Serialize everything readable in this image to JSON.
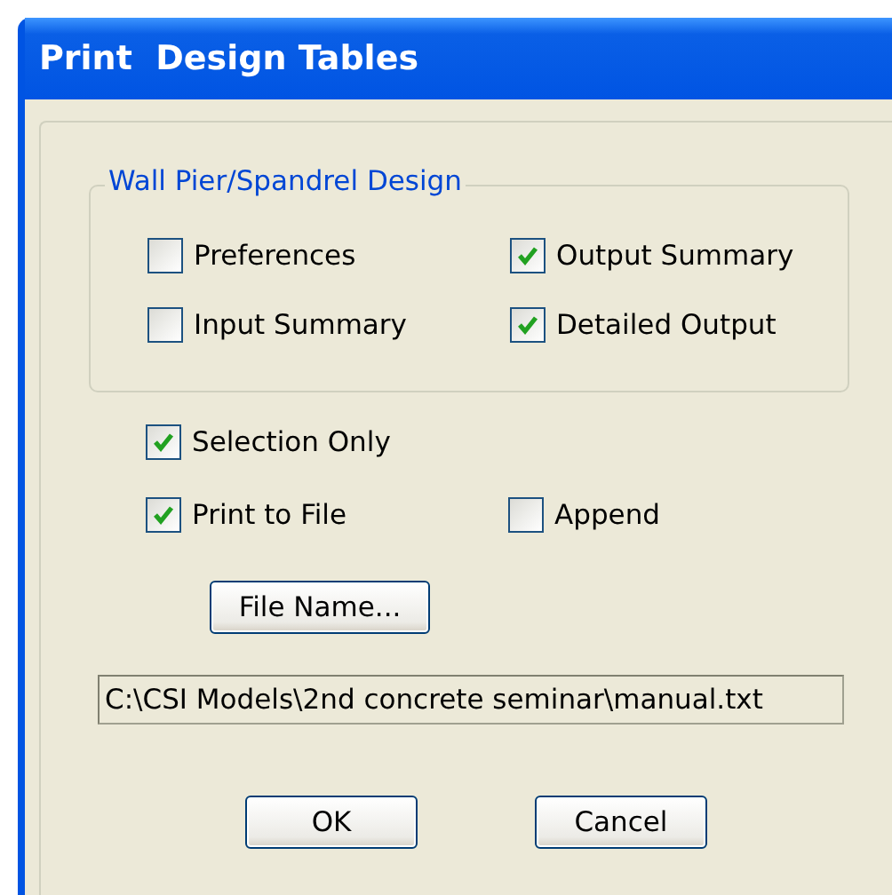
{
  "window": {
    "title": "Print  Design Tables"
  },
  "group": {
    "title": "Wall Pier/Spandrel Design",
    "options": [
      {
        "label": "Preferences",
        "checked": false
      },
      {
        "label": "Output Summary",
        "checked": true
      },
      {
        "label": "Input Summary",
        "checked": false
      },
      {
        "label": "Detailed Output",
        "checked": true
      }
    ]
  },
  "selection_only": {
    "label": "Selection Only",
    "checked": true
  },
  "print_to_file": {
    "label": "Print to File",
    "checked": true
  },
  "append": {
    "label": "Append",
    "checked": false
  },
  "file_name_button": "File Name...",
  "file_path": {
    "value": "C:\\CSI Models\\2nd concrete seminar\\manual.txt"
  },
  "buttons": [
    "OK",
    "Cancel"
  ]
}
